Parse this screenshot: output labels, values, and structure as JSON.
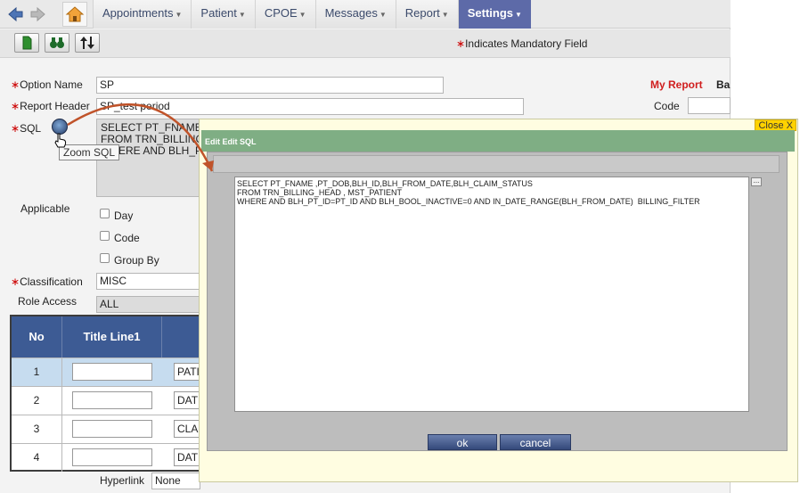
{
  "nav": {
    "menu": [
      "Appointments",
      "Patient",
      "CPOE",
      "Messages",
      "Report",
      "Settings"
    ],
    "active": "Settings"
  },
  "toolbar": {
    "mandatory_note": "Indicates Mandatory Field"
  },
  "form": {
    "option_name_label": "Option Name",
    "option_name_value": "SP",
    "report_header_label": "Report Header",
    "report_header_value": "SP_test period",
    "sql_label": "SQL",
    "sql_preview": "SELECT PT_FNAME\nFROM TRN_BILLING\nWHERE AND BLH_P",
    "zoom_tooltip": "Zoom SQL",
    "applicable_label": "Applicable",
    "opt_day": "Day",
    "opt_code": "Code",
    "opt_group_by": "Group By",
    "classification_label": "Classification",
    "classification_value": "MISC",
    "role_access_label": "Role Access",
    "role_access_value": "ALL",
    "my_report": "My Report",
    "ba": "Ba",
    "code_label": "Code",
    "hyperlink_label": "Hyperlink",
    "hyperlink_value": "None"
  },
  "table": {
    "headers": [
      "No",
      "Title Line1"
    ],
    "rows": [
      {
        "no": "1",
        "sel": "PATI"
      },
      {
        "no": "2",
        "sel": "DATE"
      },
      {
        "no": "3",
        "sel": "CLAI"
      },
      {
        "no": "4",
        "sel": "DATE"
      }
    ]
  },
  "dialog": {
    "close": "Close X",
    "title": "Edit Edit SQL",
    "sql": "SELECT PT_FNAME ,PT_DOB,BLH_ID,BLH_FROM_DATE,BLH_CLAIM_STATUS\nFROM TRN_BILLING_HEAD , MST_PATIENT\nWHERE AND BLH_PT_ID=PT_ID AND BLH_BOOL_INACTIVE=0 AND IN_DATE_RANGE(BLH_FROM_DATE)  BILLING_FILTER",
    "ok": "ok",
    "cancel": "cancel"
  }
}
